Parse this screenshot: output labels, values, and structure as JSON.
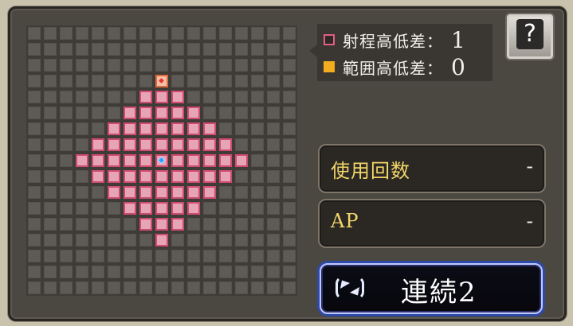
{
  "range_legend": {
    "range_height_diff": {
      "label": "射程高低差：",
      "value": "1",
      "color": "#e45c89"
    },
    "area_height_diff": {
      "label": "範囲高低差：",
      "value": "0",
      "color": "#f2ad1f"
    }
  },
  "help": {
    "label": "?"
  },
  "stats": {
    "uses": {
      "label": "使用回数",
      "value": "-"
    },
    "ap": {
      "label": "AP",
      "value": "-"
    }
  },
  "combo_button": {
    "label": "連続2"
  }
}
